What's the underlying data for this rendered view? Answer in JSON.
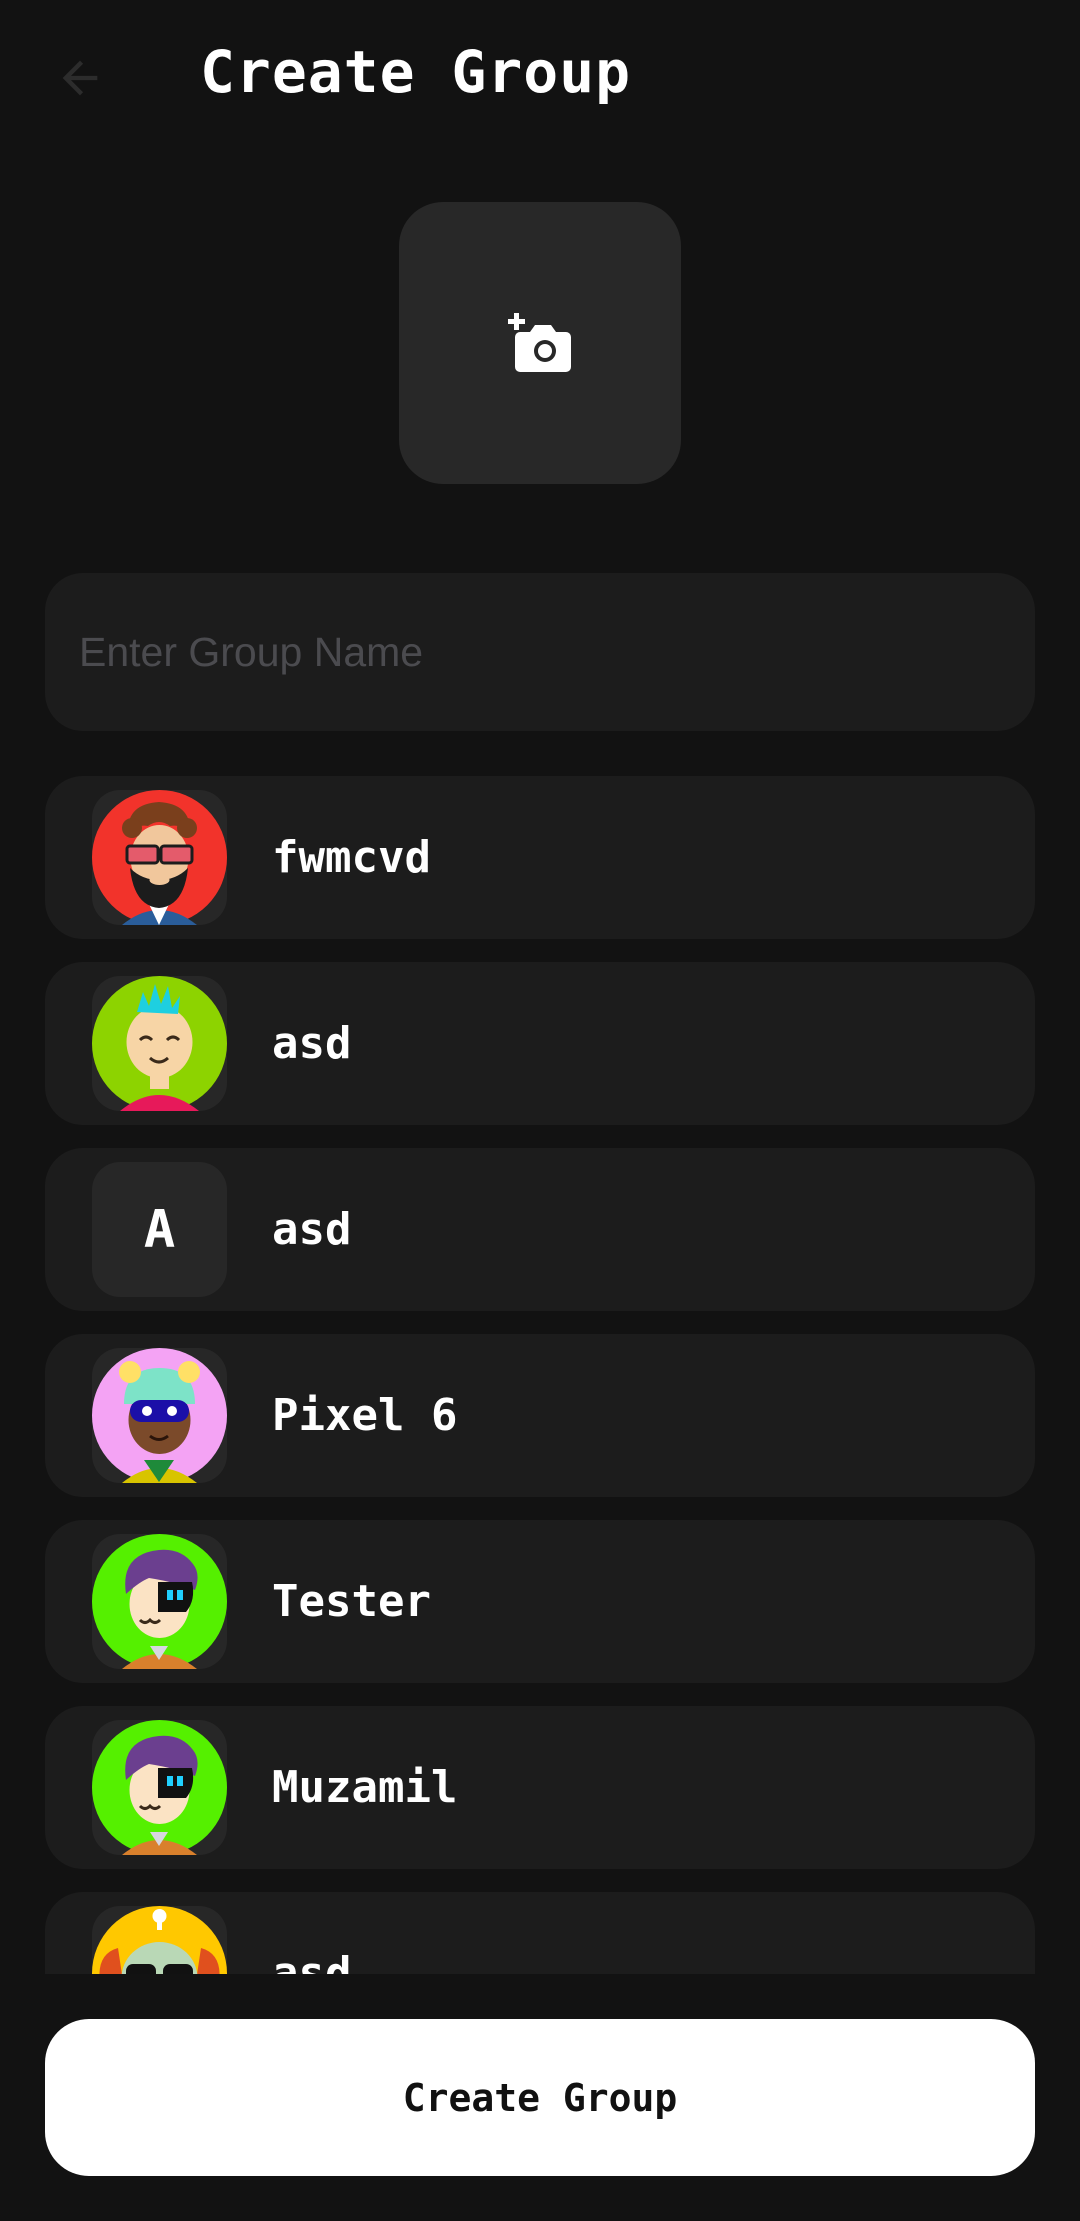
{
  "header": {
    "title": "Create Group",
    "back_icon": "arrow-left-icon"
  },
  "photo": {
    "icon": "add-camera-icon"
  },
  "group_name": {
    "value": "",
    "placeholder": "Enter Group Name"
  },
  "contacts": [
    {
      "name": "fwmcvd",
      "avatar": "avatar-bearded-sunglasses",
      "bg": "#f2332b"
    },
    {
      "name": "asd",
      "avatar": "avatar-blue-hair-smile",
      "bg": "#8dd300"
    },
    {
      "name": "asd",
      "avatar_letter": "A"
    },
    {
      "name": "Pixel 6",
      "avatar": "avatar-visor-bear-hat",
      "bg": "#f4a3f4"
    },
    {
      "name": "Tester",
      "avatar": "avatar-purple-hair-eyepatch",
      "bg": "#55f000"
    },
    {
      "name": "Muzamil",
      "avatar": "avatar-purple-hair-eyepatch",
      "bg": "#55f000"
    },
    {
      "name": "asd",
      "avatar": "avatar-robot-sunglasses",
      "bg": "#ffc800"
    }
  ],
  "footer": {
    "create_label": "Create Group"
  },
  "colors": {
    "background": "#121212",
    "card": "#1c1c1c",
    "tile": "#282828",
    "button": "#ffffff"
  }
}
